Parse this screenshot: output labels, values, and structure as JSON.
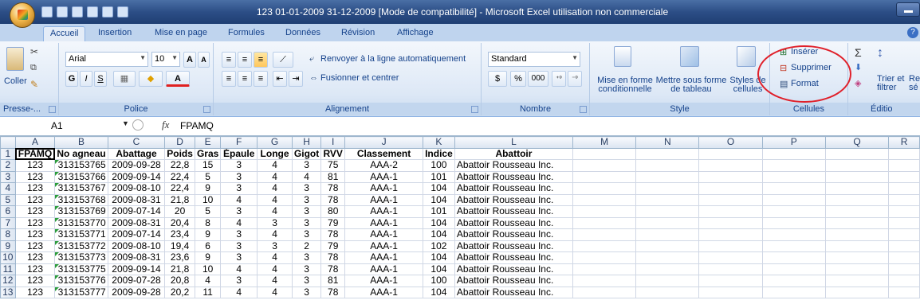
{
  "window": {
    "title": "123  01-01-2009  31-12-2009  [Mode de compatibilité]  -  Microsoft Excel utilisation non commerciale"
  },
  "tabs": [
    "Accueil",
    "Insertion",
    "Mise en page",
    "Formules",
    "Données",
    "Révision",
    "Affichage"
  ],
  "help": "?",
  "ribbon": {
    "clipboard": {
      "paste": "Coller",
      "label": "Presse-..."
    },
    "font": {
      "name": "Arial",
      "size": "10",
      "grow": "A",
      "shrink": "A",
      "bold": "G",
      "italic": "I",
      "underline": "S",
      "color": "A",
      "label": "Police"
    },
    "alignment": {
      "wrap": "Renvoyer à la ligne automatiquement",
      "merge": "Fusionner et centrer",
      "label": "Alignement"
    },
    "number": {
      "format": "Standard",
      "currency": "$",
      "percent": "%",
      "thousands": "000",
      "label": "Nombre"
    },
    "style": {
      "conditional": "Mise en forme conditionnelle",
      "table": "Mettre sous forme de tableau",
      "cell_styles": "Styles de cellules",
      "label": "Style"
    },
    "cells": {
      "insert": "Insérer",
      "delete": "Supprimer",
      "format": "Format",
      "label": "Cellules"
    },
    "editing": {
      "sort": "Trier et filtrer",
      "search": "Re sé",
      "label": "Éditio"
    }
  },
  "formula_bar": {
    "name_box": "A1",
    "fx": "fx",
    "value": "FPAMQ"
  },
  "columns": [
    "A",
    "B",
    "C",
    "D",
    "E",
    "F",
    "G",
    "H",
    "I",
    "J",
    "K",
    "L",
    "M",
    "N",
    "O",
    "P",
    "Q",
    "R"
  ],
  "header_row": [
    "FPAMQ",
    "No agneau",
    "Abattage",
    "Poids",
    "Gras",
    "Épaule",
    "Longe",
    "Gigot",
    "RVV",
    "Classement",
    "Indice",
    "Abattoir"
  ],
  "rows": [
    [
      "123",
      "313153765",
      "2009-09-28",
      "22,8",
      "15",
      "3",
      "4",
      "3",
      "75",
      "AAA-2",
      "100",
      "Abattoir Rousseau Inc."
    ],
    [
      "123",
      "313153766",
      "2009-09-14",
      "22,4",
      "5",
      "3",
      "4",
      "4",
      "81",
      "AAA-1",
      "101",
      "Abattoir Rousseau Inc."
    ],
    [
      "123",
      "313153767",
      "2009-08-10",
      "22,4",
      "9",
      "3",
      "4",
      "3",
      "78",
      "AAA-1",
      "104",
      "Abattoir Rousseau Inc."
    ],
    [
      "123",
      "313153768",
      "2009-08-31",
      "21,8",
      "10",
      "4",
      "4",
      "3",
      "78",
      "AAA-1",
      "104",
      "Abattoir Rousseau Inc."
    ],
    [
      "123",
      "313153769",
      "2009-07-14",
      "20",
      "5",
      "3",
      "4",
      "3",
      "80",
      "AAA-1",
      "101",
      "Abattoir Rousseau Inc."
    ],
    [
      "123",
      "313153770",
      "2009-08-31",
      "20,4",
      "8",
      "4",
      "3",
      "3",
      "79",
      "AAA-1",
      "104",
      "Abattoir Rousseau Inc."
    ],
    [
      "123",
      "313153771",
      "2009-07-14",
      "23,4",
      "9",
      "3",
      "4",
      "3",
      "78",
      "AAA-1",
      "104",
      "Abattoir Rousseau Inc."
    ],
    [
      "123",
      "313153772",
      "2009-08-10",
      "19,4",
      "6",
      "3",
      "3",
      "2",
      "79",
      "AAA-1",
      "102",
      "Abattoir Rousseau Inc."
    ],
    [
      "123",
      "313153773",
      "2009-08-31",
      "23,6",
      "9",
      "3",
      "4",
      "3",
      "78",
      "AAA-1",
      "104",
      "Abattoir Rousseau Inc."
    ],
    [
      "123",
      "313153775",
      "2009-09-14",
      "21,8",
      "10",
      "4",
      "4",
      "3",
      "78",
      "AAA-1",
      "104",
      "Abattoir Rousseau Inc."
    ],
    [
      "123",
      "313153776",
      "2009-07-28",
      "20,8",
      "4",
      "3",
      "4",
      "3",
      "81",
      "AAA-1",
      "100",
      "Abattoir Rousseau Inc."
    ],
    [
      "123",
      "313153777",
      "2009-09-28",
      "20,2",
      "11",
      "4",
      "4",
      "3",
      "78",
      "AAA-1",
      "104",
      "Abattoir Rousseau Inc."
    ]
  ],
  "colors": {
    "accent": "#15428b",
    "annotation": "#e0202a",
    "error_marker": "#2a9c3a"
  }
}
